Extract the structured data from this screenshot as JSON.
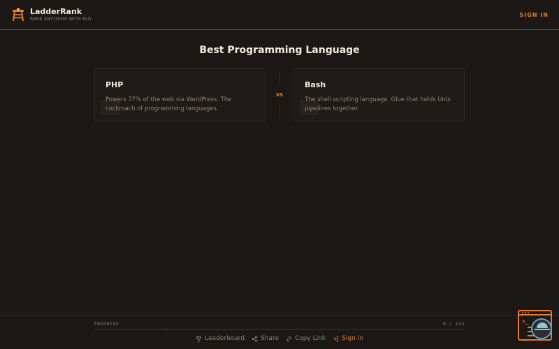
{
  "app": {
    "name": "LadderRank",
    "tagline": "RANK ANYTHING WITH ELO",
    "sign_in_label": "SIGN IN"
  },
  "matchup": {
    "title": "Best Programming Language",
    "vs_label": "VS",
    "left": {
      "name": "PHP",
      "description": "Powers 77% of the web via WordPress. The cockroach of programming languages."
    },
    "right": {
      "name": "Bash",
      "description": "The shell scripting language. Glue that holds Unix pipelines together."
    }
  },
  "progress": {
    "label": "PROGRESS",
    "count_text": "0 / 143",
    "completed": 0,
    "total": 143
  },
  "footer": {
    "links": [
      {
        "label": "Leaderboard",
        "icon": "trophy-icon"
      },
      {
        "label": "Share",
        "icon": "share-icon"
      },
      {
        "label": "Copy Link",
        "icon": "link-icon"
      },
      {
        "label": "Sign in",
        "icon": "sign-in-icon"
      }
    ]
  },
  "colors": {
    "background": "#1b1816",
    "accent": "#e37b31",
    "card": "#1e1b19",
    "muted_text": "#8a847c"
  }
}
